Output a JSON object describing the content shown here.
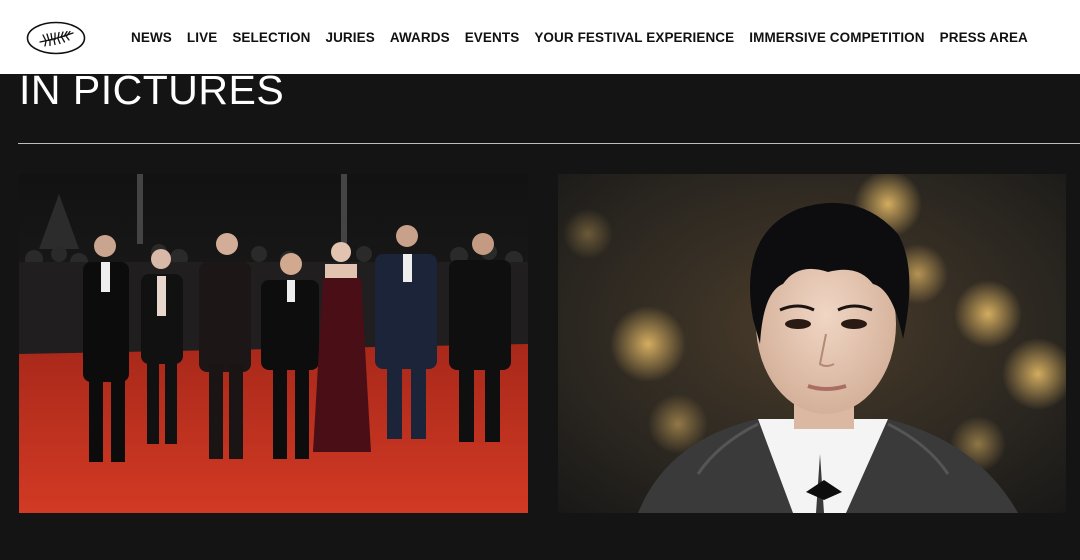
{
  "nav": {
    "logo_icon": "cannes-palm-logo-icon",
    "items": [
      {
        "label": "NEWS"
      },
      {
        "label": "LIVE"
      },
      {
        "label": "SELECTION"
      },
      {
        "label": "JURIES"
      },
      {
        "label": "AWARDS"
      },
      {
        "label": "EVENTS"
      },
      {
        "label": "YOUR FESTIVAL EXPERIENCE"
      },
      {
        "label": "IMMERSIVE COMPETITION"
      },
      {
        "label": "PRESS AREA"
      }
    ]
  },
  "main": {
    "section_title": "IN PICTURES",
    "photos": [
      {
        "kind": "group-red-carpet-photo"
      },
      {
        "kind": "portrait-photo"
      }
    ]
  },
  "colors": {
    "page_background": "#141414",
    "nav_background": "#ffffff",
    "red_carpet": "#c7321f",
    "divider": "#bdbdbd"
  }
}
